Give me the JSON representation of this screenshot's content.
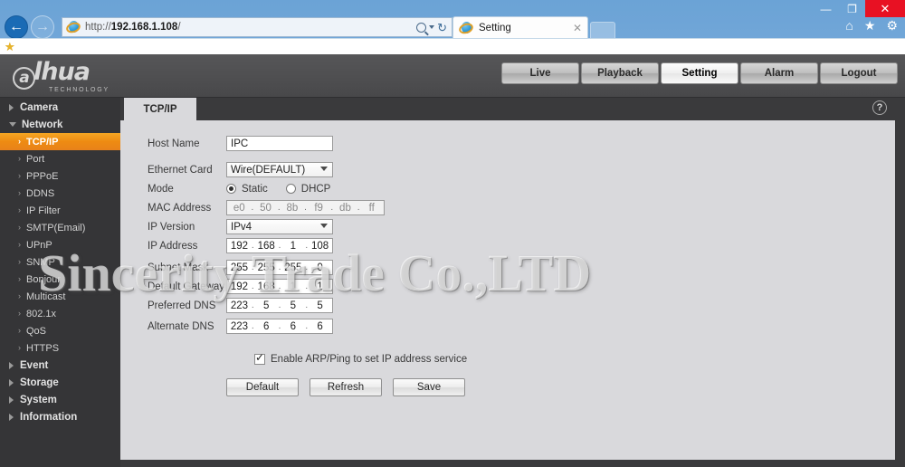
{
  "browser": {
    "url_prefix": "http://",
    "url_host": "192.168.1.108",
    "url_suffix": "/",
    "back_label": "←",
    "forward_label": "→",
    "search_icon": "search-icon",
    "refresh_glyph": "↻",
    "minimize_glyph": "—",
    "maximize_glyph": "❐",
    "close_glyph": "✕",
    "home_glyph": "⌂",
    "favorites_glyph": "★",
    "tools_glyph": "⚙",
    "favbar_star_glyph": "★",
    "tabs": [
      {
        "label": "Setting",
        "close_glyph": "✕"
      }
    ],
    "new_tab_label": ""
  },
  "app": {
    "logo": {
      "at": "a",
      "word": "lhua",
      "sub": "TECHNOLOGY"
    },
    "topnav": [
      {
        "label": "Live",
        "active": false
      },
      {
        "label": "Playback",
        "active": false
      },
      {
        "label": "Setting",
        "active": true
      },
      {
        "label": "Alarm",
        "active": false
      },
      {
        "label": "Logout",
        "active": false
      }
    ]
  },
  "sidebar": {
    "groups": [
      {
        "label": "Camera",
        "expanded": false
      },
      {
        "label": "Network",
        "expanded": true
      }
    ],
    "network_items": [
      {
        "label": "TCP/IP",
        "selected": true
      },
      {
        "label": "Port",
        "selected": false
      },
      {
        "label": "PPPoE",
        "selected": false
      },
      {
        "label": "DDNS",
        "selected": false
      },
      {
        "label": "IP Filter",
        "selected": false
      },
      {
        "label": "SMTP(Email)",
        "selected": false
      },
      {
        "label": "UPnP",
        "selected": false
      },
      {
        "label": "SNMP",
        "selected": false
      },
      {
        "label": "Bonjour",
        "selected": false
      },
      {
        "label": "Multicast",
        "selected": false
      },
      {
        "label": "802.1x",
        "selected": false
      },
      {
        "label": "QoS",
        "selected": false
      },
      {
        "label": "HTTPS",
        "selected": false
      }
    ],
    "bottom_groups": [
      {
        "label": "Event"
      },
      {
        "label": "Storage"
      },
      {
        "label": "System"
      },
      {
        "label": "Information"
      }
    ],
    "chevron_glyph": "›",
    "selected_color": "#ee8b12"
  },
  "content": {
    "tab_label": "TCP/IP",
    "help_glyph": "?",
    "form": {
      "host_name": {
        "label": "Host Name",
        "value": "IPC"
      },
      "ethernet_card": {
        "label": "Ethernet Card",
        "value": "Wire(DEFAULT)"
      },
      "mode": {
        "label": "Mode",
        "options": [
          {
            "label": "Static",
            "selected": true
          },
          {
            "label": "DHCP",
            "selected": false
          }
        ]
      },
      "mac_address": {
        "label": "MAC Address",
        "segments": [
          "e0",
          "50",
          "8b",
          "f9",
          "db",
          "ff"
        ],
        "disabled": true
      },
      "ip_version": {
        "label": "IP Version",
        "value": "IPv4"
      },
      "ip_address": {
        "label": "IP Address",
        "segments": [
          "192",
          "168",
          "1",
          "108"
        ]
      },
      "subnet_mask": {
        "label": "Subnet Mask",
        "segments": [
          "255",
          "255",
          "255",
          "0"
        ]
      },
      "default_gateway": {
        "label": "Default Gateway",
        "segments": [
          "192",
          "168",
          "1",
          "1"
        ]
      },
      "preferred_dns": {
        "label": "Preferred DNS",
        "segments": [
          "223",
          "5",
          "5",
          "5"
        ]
      },
      "alternate_dns": {
        "label": "Alternate DNS",
        "segments": [
          "223",
          "6",
          "6",
          "6"
        ]
      },
      "arp_ping": {
        "label": "Enable ARP/Ping to set IP address service",
        "checked": true
      }
    },
    "buttons": [
      {
        "label": "Default"
      },
      {
        "label": "Refresh"
      },
      {
        "label": "Save"
      }
    ]
  },
  "watermark": {
    "text": "Sincerity Trade Co.,LTD"
  }
}
